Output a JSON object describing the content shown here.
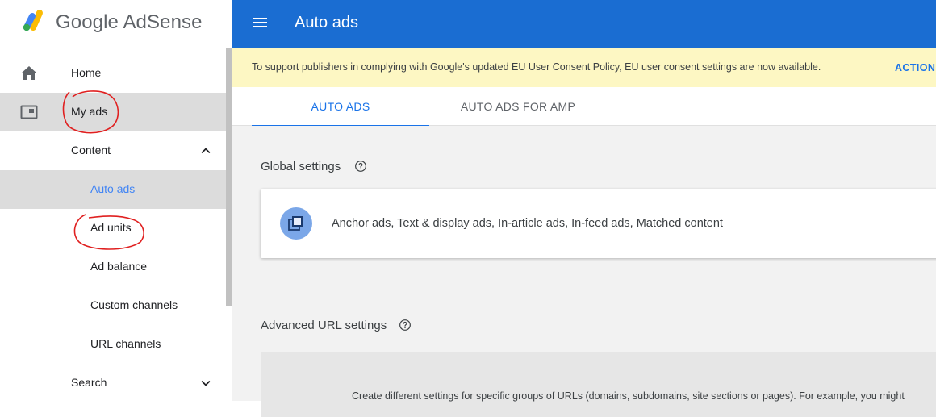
{
  "brand": {
    "name_google": "Google",
    "name_product": "AdSense",
    "colors": {
      "yellow": "#fbbc04",
      "green": "#34a853",
      "blue": "#4285f4"
    }
  },
  "sidebar": {
    "items": [
      {
        "id": "home",
        "label": "Home",
        "icon": "home-icon"
      },
      {
        "id": "my-ads",
        "label": "My ads",
        "icon": "ad-unit-icon",
        "selected": true
      },
      {
        "id": "content",
        "label": "Content",
        "icon": "chevron-up-icon",
        "expanded": true
      },
      {
        "id": "auto-ads",
        "label": "Auto ads",
        "selected": true
      },
      {
        "id": "ad-units",
        "label": "Ad units"
      },
      {
        "id": "ad-balance",
        "label": "Ad balance"
      },
      {
        "id": "custom-channels",
        "label": "Custom channels"
      },
      {
        "id": "url-channels",
        "label": "URL channels"
      },
      {
        "id": "search",
        "label": "Search",
        "icon": "chevron-down-icon",
        "expanded": false
      }
    ]
  },
  "topbar": {
    "title": "Auto ads",
    "color": "#1a6dd2",
    "menu_icon": "hamburger-menu-icon"
  },
  "banner": {
    "text": "To support publishers in complying with Google's updated EU User Consent Policy, EU user consent settings are now available.",
    "action": "ACTION",
    "color": "#fdf7c3"
  },
  "tabs": [
    {
      "label": "AUTO ADS",
      "active": true
    },
    {
      "label": "AUTO ADS FOR AMP",
      "active": false
    }
  ],
  "global_settings": {
    "title": "Global settings",
    "help_icon": "help-circle-icon",
    "card_text": "Anchor ads, Text & display ads, In-article ads, In-feed ads, Matched content",
    "card_icon": "ad-formats-icon"
  },
  "advanced": {
    "title": "Advanced URL settings",
    "help_icon": "help-circle-icon",
    "description": "Create different settings for specific groups of URLs (domains, subdomains, site sections or pages). For example, you might"
  },
  "accent": "#1a73e8"
}
